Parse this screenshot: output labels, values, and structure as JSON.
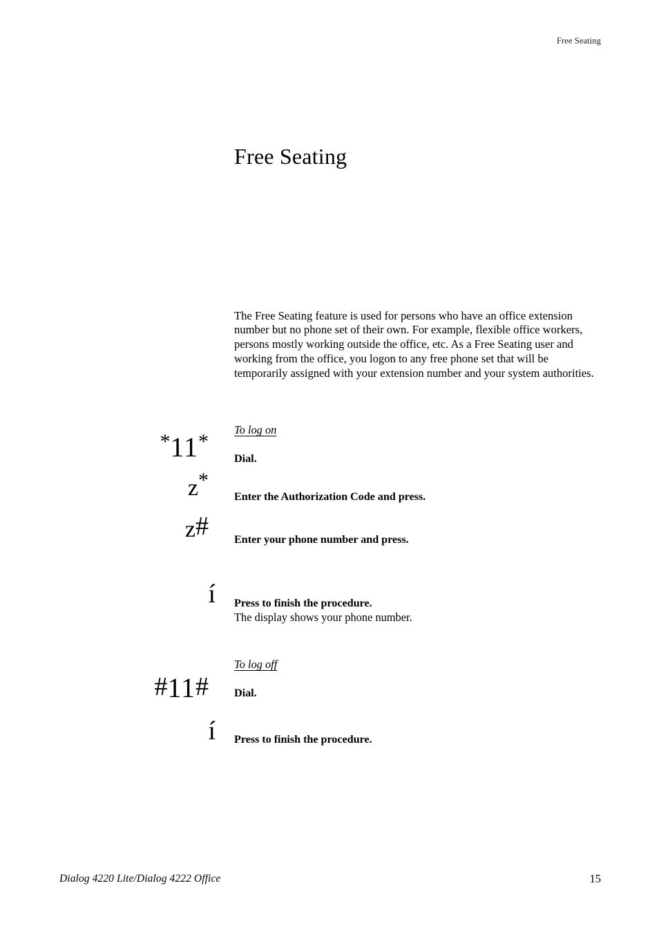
{
  "header": {
    "running_head": "Free Seating"
  },
  "title": "Free Seating",
  "intro": "The Free Seating feature is used for persons who have an office extension number but no phone set of their own. For example, flexible office workers, persons mostly working outside the office, etc. As a Free Seating user and working from the office, you logon to any free phone set that will be temporarily assigned with your extension number and your system authorities.",
  "procedures": [
    {
      "section_label": "To log on",
      "keys": "*11*",
      "key_parts": {
        "star1": "*",
        "digits": "11",
        "star2": "*"
      },
      "instruction": "Dial.",
      "note": ""
    },
    {
      "section_label": "",
      "keys": "z*",
      "key_parts": {
        "z": "z",
        "star2": "*"
      },
      "instruction": "Enter the Authorization Code and press.",
      "note": ""
    },
    {
      "section_label": "",
      "keys": "z#",
      "key_parts": {
        "z": "z",
        "hash": "#"
      },
      "instruction": "Enter your phone number and press.",
      "note": ""
    },
    {
      "section_label": "",
      "keys": "í",
      "key_parts": {
        "clear": "í"
      },
      "instruction": "Press to finish the procedure.",
      "note": "The display shows your phone number."
    },
    {
      "section_label": "To log off",
      "keys": "#11#",
      "key_parts": {
        "hash1": "#",
        "digits": "11",
        "hash2": "#"
      },
      "instruction": "Dial.",
      "note": ""
    },
    {
      "section_label": "",
      "keys": "í",
      "key_parts": {
        "clear": "í"
      },
      "instruction": "Press to finish the procedure.",
      "note": ""
    }
  ],
  "footer": {
    "document_name": "Dialog 4220 Lite/Dialog 4222 Office",
    "page_number": "15"
  },
  "colors": {
    "page_background": "#ffffff",
    "text": "#000000"
  }
}
